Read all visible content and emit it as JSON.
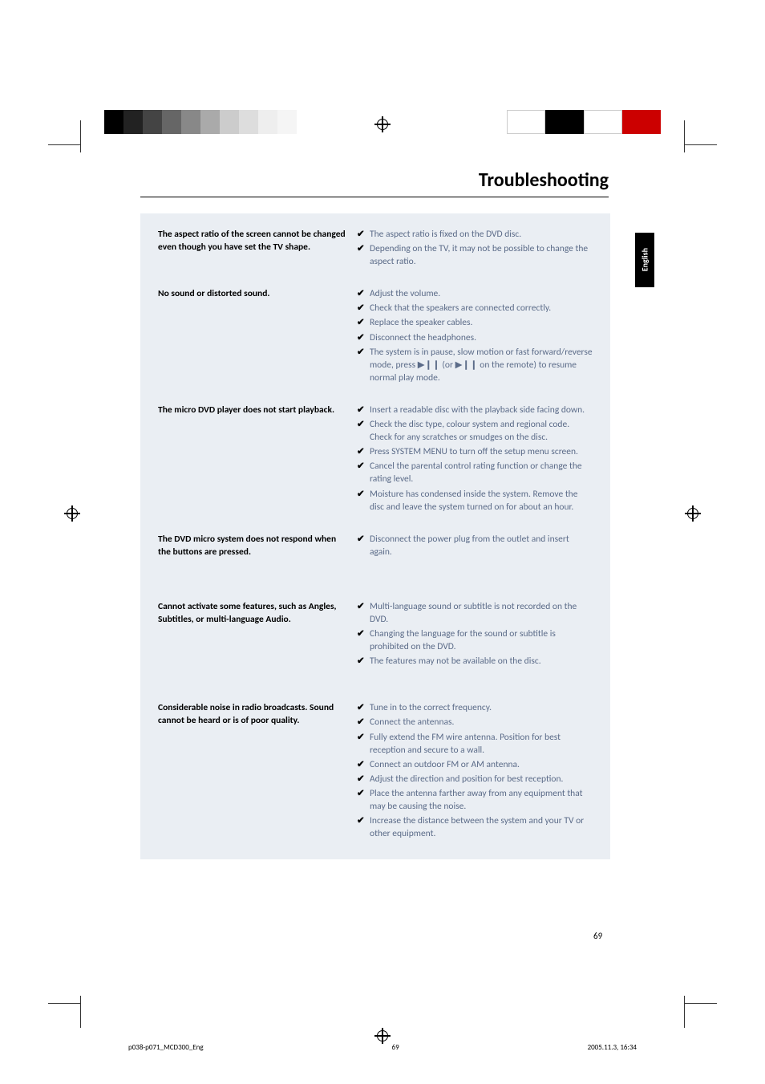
{
  "page": {
    "title": "Troubleshooting",
    "language_tab": "English",
    "page_number": "69"
  },
  "troubleshooting": [
    {
      "problem": "The aspect ratio of the screen cannot be changed even though you have set the TV shape.",
      "solutions": [
        "The aspect ratio is fixed on the DVD disc.",
        "Depending on the TV, it may not be possible to change the aspect ratio."
      ]
    },
    {
      "problem": "No sound or distorted sound.",
      "solutions": [
        "Adjust the volume.",
        "Check that the speakers are connected correctly.",
        "Replace the speaker cables.",
        "Disconnect the headphones.",
        "The system is in pause, slow motion or fast forward/reverse mode, press ▶❙❙ (or ▶❙❙ on the remote) to resume normal play mode."
      ]
    },
    {
      "problem": "The micro DVD player does not start playback.",
      "solutions": [
        "Insert a readable disc with the playback side facing down.",
        "Check the disc type, colour system and regional code. Check for any scratches or smudges on the disc.",
        "Press SYSTEM MENU to turn off the setup menu screen.",
        "Cancel the parental control rating function or change the rating level.",
        "Moisture has condensed inside the system. Remove the disc and leave the system turned on for about an hour."
      ]
    },
    {
      "problem": "The DVD micro system does not respond when the buttons are pressed.",
      "solutions": [
        "Disconnect the power plug from the outlet and insert again."
      ]
    },
    {
      "problem": "Cannot activate some features, such as Angles, Subtitles, or multi-language Audio.",
      "solutions": [
        "Multi-language sound or subtitle is not recorded on the DVD.",
        "Changing the language for the sound or subtitle is prohibited on the DVD.",
        "The features may not be available on the disc."
      ]
    },
    {
      "problem": "Considerable noise in radio broadcasts. Sound cannot be heard or is of poor quality.",
      "solutions": [
        "Tune in to the correct frequency.",
        "Connect the antennas.",
        "Fully extend the FM wire antenna. Position for best reception and secure to a wall.",
        "Connect an outdoor FM or AM antenna.",
        "Adjust the direction and position for best reception.",
        "Place the antenna farther away from any equipment that may be causing the noise.",
        "Increase the distance between the system and your TV or other equipment."
      ]
    }
  ],
  "footer": {
    "file": "p038-p071_MCD300_Eng",
    "page": "69",
    "timestamp": "2005.11.3, 16:34"
  },
  "row_extra_margin": [
    0,
    0,
    0,
    28,
    18,
    0
  ]
}
